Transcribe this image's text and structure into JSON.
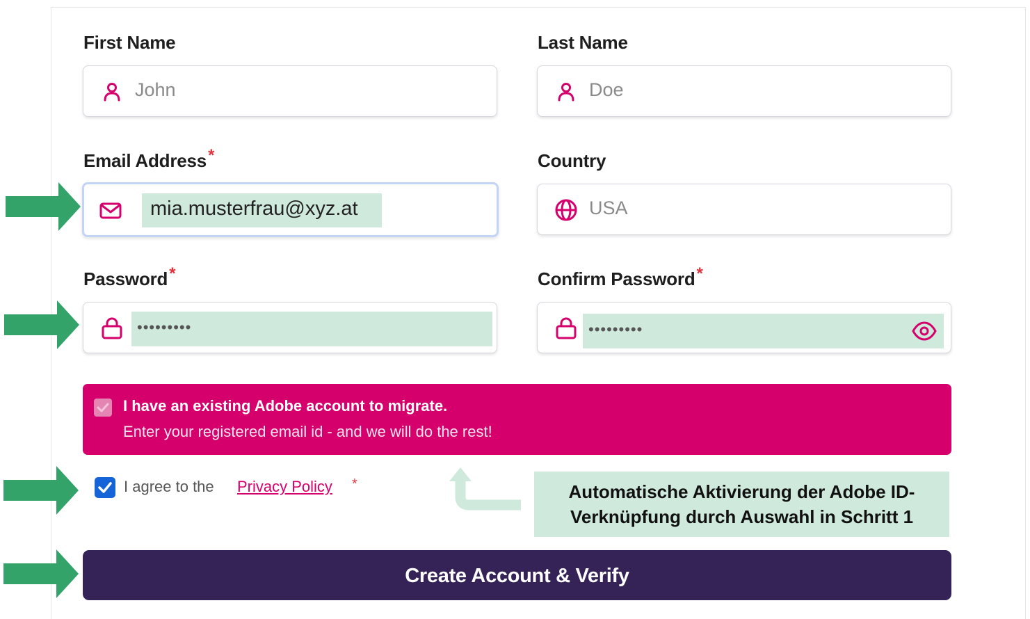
{
  "form": {
    "first_name": {
      "label": "First Name",
      "placeholder": "John",
      "icon": "user-icon"
    },
    "last_name": {
      "label": "Last Name",
      "placeholder": "Doe",
      "icon": "user-icon"
    },
    "email": {
      "label": "Email Address",
      "required_mark": "*",
      "value": "mia.musterfrau@xyz.at",
      "icon": "mail-icon"
    },
    "country": {
      "label": "Country",
      "value": "USA",
      "icon": "globe-icon"
    },
    "password": {
      "label": "Password",
      "required_mark": "*",
      "masked_value": "•••••••••",
      "icon": "lock-icon"
    },
    "confirm_password": {
      "label": "Confirm Password",
      "required_mark": "*",
      "masked_value": "•••••••••",
      "icon": "lock-icon",
      "toggle_icon": "eye-icon"
    },
    "migrate_banner": {
      "checked": true,
      "title": "I have an existing Adobe account to migrate.",
      "subtitle": "Enter your registered email id - and we will do the rest!"
    },
    "agree": {
      "checked": true,
      "text": "I agree to the",
      "link_text": "Privacy Policy",
      "required_mark": "*"
    },
    "submit_label": "Create Account & Verify"
  },
  "annotation": {
    "note_line1": "Automatische Aktivierung der Adobe ID-",
    "note_line2": "Verknüpfung durch Auswahl in Schritt 1"
  },
  "colors": {
    "accent_pink": "#d5006b",
    "button_purple": "#352257",
    "highlight_green": "#cfe9dc",
    "arrow_green": "#33a36a",
    "required_red": "#e0353f",
    "checkbox_blue": "#1565d8"
  }
}
